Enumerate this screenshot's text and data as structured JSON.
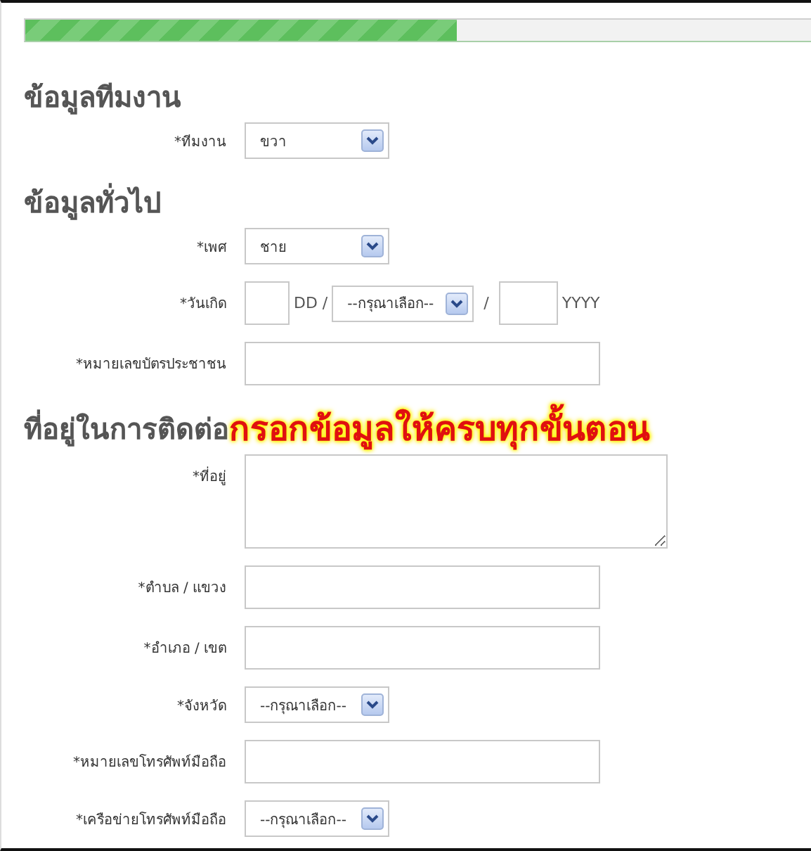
{
  "progress": {
    "level": 0.55
  },
  "sections": [
    {
      "heading": "ข้อมูลทีมงาน",
      "fields": [
        {
          "kind": "select",
          "label": "*ทีมงาน",
          "value": "ขวา"
        }
      ]
    },
    {
      "heading": "ข้อมูลทั่วไป",
      "fields": [
        {
          "kind": "select",
          "label": "*เพศ",
          "value": "ชาย"
        },
        {
          "kind": "date",
          "label": "*วันเกิด",
          "day_hint": "DD /",
          "month": "--กรุณาเลือก--",
          "separator": "/",
          "year_hint": "YYYY"
        },
        {
          "kind": "text",
          "label": "*หมายเลขบัตรประชาชน"
        }
      ]
    },
    {
      "heading": "ที่อยู่ในการติดต่อ",
      "annotation": "กรอกข้อมูลให้ครบทุกขั้นตอน",
      "fields": [
        {
          "kind": "textarea",
          "label": "*ที่อยู่"
        },
        {
          "kind": "text",
          "label": "*ตำบล / แขวง"
        },
        {
          "kind": "text",
          "label": "*อำเภอ / เขต"
        },
        {
          "kind": "select",
          "label": "*จังหวัด",
          "value": "--กรุณาเลือก--"
        },
        {
          "kind": "text",
          "label": "*หมายเลขโทรศัพท์มือถือ"
        },
        {
          "kind": "select",
          "label": "*เครือข่ายโทรศัพท์มือถือ",
          "value": "--กรุณาเลือก--"
        }
      ]
    }
  ]
}
